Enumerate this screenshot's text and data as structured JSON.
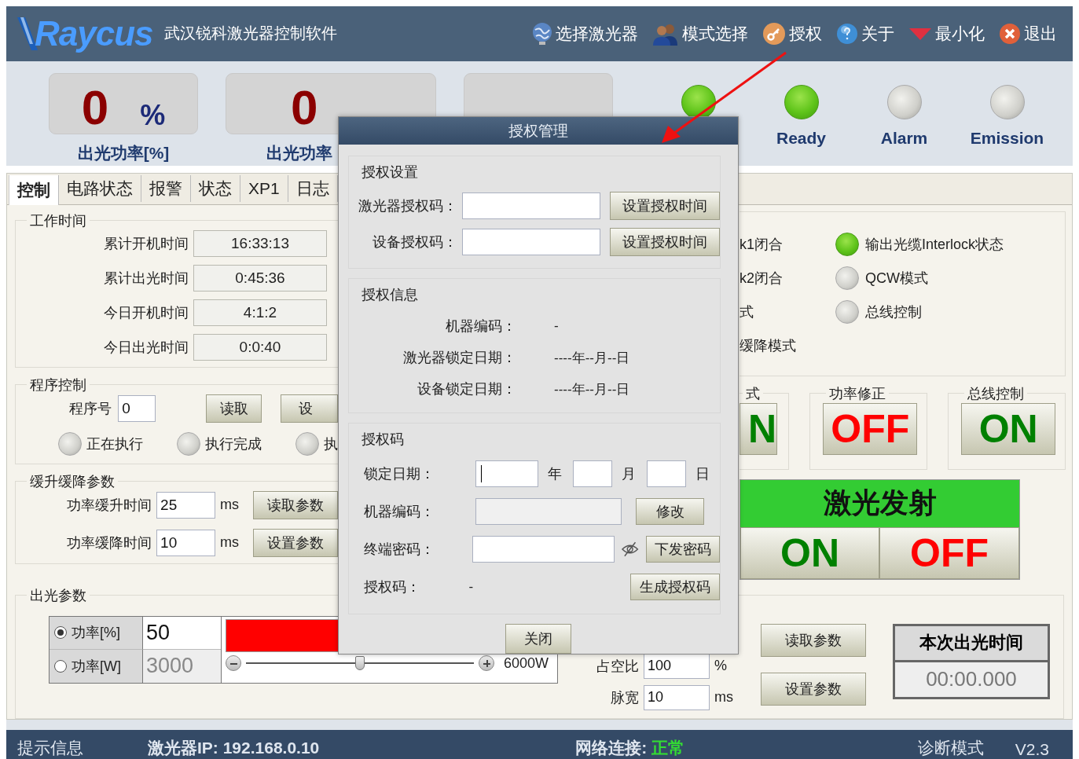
{
  "header": {
    "logo": "Raycus",
    "title": "武汉锐科激光器控制软件",
    "menu": [
      {
        "label": "选择激光器"
      },
      {
        "label": "模式选择"
      },
      {
        "label": "授权"
      },
      {
        "label": "关于"
      },
      {
        "label": "最小化"
      },
      {
        "label": "退出"
      }
    ]
  },
  "gauges": [
    {
      "kind": "reading",
      "value": "0",
      "unit": "%",
      "label": "出光功率[%]"
    },
    {
      "kind": "reading",
      "value": "0",
      "label": "出光功率"
    },
    {
      "kind": "covered"
    }
  ],
  "indicators": [
    {
      "on": true
    },
    {
      "label": "Ready",
      "on": true
    },
    {
      "label": "Alarm",
      "on": false
    },
    {
      "label": "Emission",
      "on": false
    }
  ],
  "tabs": [
    {
      "label": "控制",
      "selected": true
    },
    {
      "label": "电路状态",
      "selected": false
    },
    {
      "label": "报警",
      "selected": false
    },
    {
      "label": "状态",
      "selected": false
    },
    {
      "label": "XP1",
      "selected": false
    },
    {
      "label": "日志",
      "selected": false
    }
  ],
  "work_time": {
    "title": "工作时间",
    "rows": [
      {
        "label": "累计开机时间",
        "value": "16:33:13"
      },
      {
        "label": "累计出光时间",
        "value": "0:45:36"
      },
      {
        "label": "今日开机时间",
        "value": "4:1:2"
      },
      {
        "label": "今日出光时间",
        "value": "0:0:40"
      }
    ]
  },
  "program_control": {
    "title": "程序控制",
    "number_label": "程序号",
    "number": "0",
    "buttons": [
      "读取",
      "设"
    ],
    "states": [
      {
        "label": "正在执行",
        "on": false
      },
      {
        "label": "执行完成",
        "on": false
      },
      {
        "label": "执",
        "on": false
      }
    ]
  },
  "ramp": {
    "title": "缓升缓降参数",
    "rows": [
      {
        "label": "功率缓升时间",
        "value": "25",
        "unit": "ms",
        "button": "读取参数"
      },
      {
        "label": "功率缓降时间",
        "value": "10",
        "unit": "ms",
        "button": "设置参数"
      }
    ]
  },
  "status_lamps": {
    "column_1": [
      {
        "label": "k1闭合"
      },
      {
        "label": "k2闭合"
      },
      {
        "label": "式"
      },
      {
        "label": "缓降模式"
      }
    ],
    "column_2": [
      {
        "label": "输出光缆Interlock状态",
        "on": true
      },
      {
        "label": "QCW模式",
        "on": false
      },
      {
        "label": "总线控制",
        "on": false
      }
    ]
  },
  "switches": [
    {
      "title": "式",
      "text": "N",
      "on": true
    },
    {
      "title": "功率修正",
      "text": "OFF",
      "on": false
    },
    {
      "title": "总线控制",
      "text": "ON",
      "on": true
    }
  ],
  "emission": {
    "title": "激光发射",
    "on_button": "ON",
    "off_button": "OFF"
  },
  "output_params": {
    "title": "出光参数",
    "modes": [
      {
        "label": "功率[%]",
        "value": "50",
        "selected": true
      },
      {
        "label": "功率[W]",
        "value": "3000",
        "selected": false
      }
    ],
    "bar": {
      "level": 0.5
    },
    "slider": {
      "level": 0.5,
      "max_label": "6000W"
    },
    "duty_label": "占空比",
    "duty": "100",
    "duty_unit": "%",
    "pulse_label": "脉宽",
    "pulse": "10",
    "pulse_unit": "ms",
    "buttons": [
      "读取参数",
      "设置参数"
    ],
    "timer": {
      "title": "本次出光时间",
      "value": "00:00.000"
    }
  },
  "status_bar": {
    "hint": "提示信息",
    "ip": "激光器IP: 192.168.0.10",
    "network_label": "网络连接:",
    "network": "正常",
    "mode": "诊断模式",
    "version": "V2.3"
  },
  "dialog": {
    "title": "授权管理",
    "settings": {
      "title": "授权设置",
      "rows": [
        {
          "label": "激光器授权码：",
          "button": "设置授权时间"
        },
        {
          "label": "设备授权码：",
          "button": "设置授权时间"
        }
      ]
    },
    "info": {
      "title": "授权信息",
      "rows": [
        {
          "label": "机器编码：",
          "value": "-"
        },
        {
          "label": "激光器锁定日期：",
          "value": "----年--月--日"
        },
        {
          "label": "设备锁定日期：",
          "value": "----年--月--日"
        }
      ]
    },
    "code": {
      "title": "授权码",
      "date_label": "锁定日期：",
      "units": [
        "年",
        "月",
        "日"
      ],
      "machine_label": "机器编码：",
      "modify_button": "修改",
      "password_label": "终端密码：",
      "send_button": "下发密码",
      "code_label": "授权码：",
      "code_value": "-",
      "generate_button": "生成授权码"
    },
    "close_button": "关闭"
  }
}
